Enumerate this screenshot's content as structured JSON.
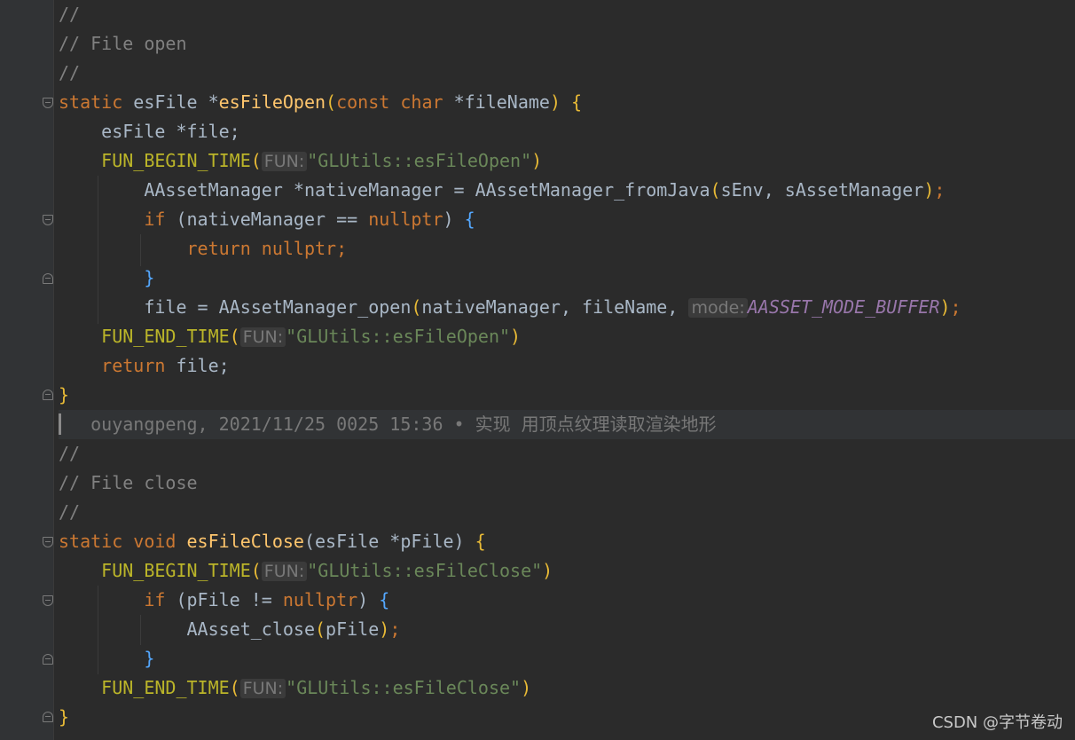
{
  "lines": {
    "l1": "//",
    "l2": "// File open",
    "l3": "//",
    "l4": {
      "kw1": "static",
      "type": " esFile *",
      "fn": "esFileOpen",
      "p1": "(",
      "kw2": "const",
      "kw3": "char",
      "arg": " *fileName",
      "p2": ")",
      "brace": " {"
    },
    "l5": "esFile *file;",
    "l6": {
      "macro": "FUN_BEGIN_TIME",
      "p1": "(",
      "hint": "FUN:",
      "str": "\"GLUtils::esFileOpen\"",
      "p2": ")"
    },
    "l7": {
      "a": "AAssetManager *nativeManager = AAssetManager_fromJava",
      "p1": "(",
      "b": "sEnv, sAssetManager",
      "p2": ")",
      "semi": ";"
    },
    "l8": {
      "kw": "if",
      "a": " (nativeManager == ",
      "kw2": "nullptr",
      "b": ") ",
      "brace": "{"
    },
    "l9": {
      "kw": "return",
      "kw2": " nullptr",
      "semi": ";"
    },
    "l10": "}",
    "l11": {
      "a": "file = AAssetManager_open",
      "p1": "(",
      "b": "nativeManager, fileName, ",
      "hint": "mode:",
      "const": "AASSET_MODE_BUFFER",
      "p2": ")",
      "semi": ";"
    },
    "l12": {
      "macro": "FUN_END_TIME",
      "p1": "(",
      "hint": "FUN:",
      "str": "\"GLUtils::esFileOpen\"",
      "p2": ")"
    },
    "l13": {
      "kw": "return",
      "a": " file;"
    },
    "l14": "}",
    "l15": "ouyangpeng, 2021/11/25 0025 15:36 • 实现 用顶点纹理读取渲染地形",
    "l16": "//",
    "l17": "// File close",
    "l18": "//",
    "l19": {
      "kw1": "static",
      "kw2": " void ",
      "fn": "esFileClose",
      "p1": "(",
      "arg": "esFile *pFile",
      "p2": ")",
      "brace": " {"
    },
    "l20": {
      "macro": "FUN_BEGIN_TIME",
      "p1": "(",
      "hint": "FUN:",
      "str": "\"GLUtils::esFileClose\"",
      "p2": ")"
    },
    "l21": {
      "kw": "if",
      "a": " (pFile != ",
      "kw2": "nullptr",
      "b": ") ",
      "brace": "{"
    },
    "l22": {
      "a": "AAsset_close",
      "p1": "(",
      "b": "pFile",
      "p2": ")",
      "semi": ";"
    },
    "l23": "}",
    "l24": {
      "macro": "FUN_END_TIME",
      "p1": "(",
      "hint": "FUN:",
      "str": "\"GLUtils::esFileClose\"",
      "p2": ")"
    },
    "l25": "}"
  },
  "watermark": "CSDN @字节卷动"
}
